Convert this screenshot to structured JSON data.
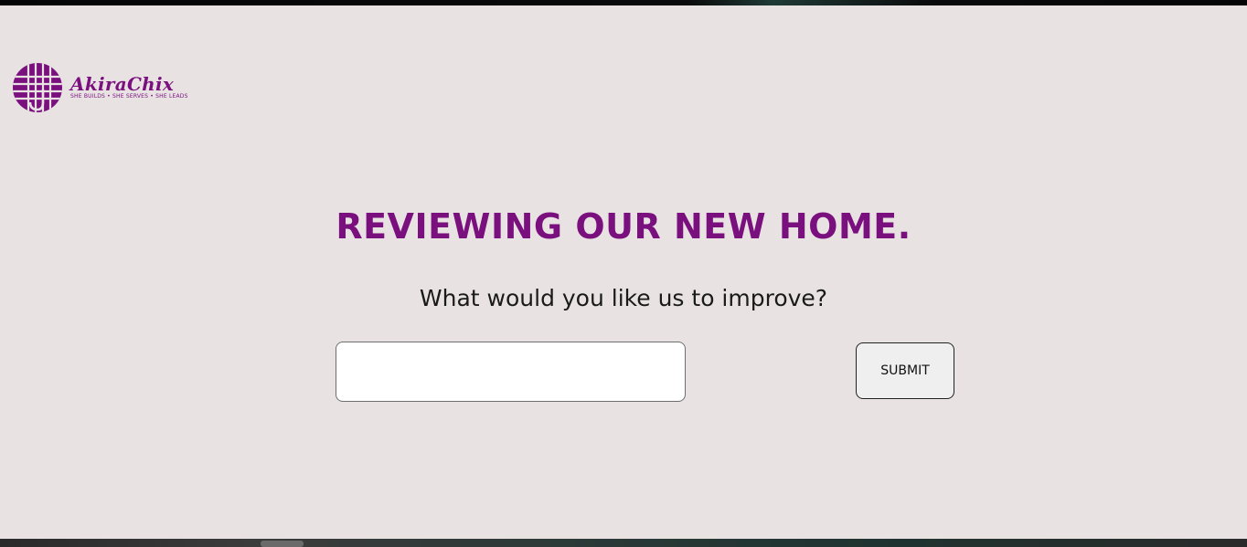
{
  "logo": {
    "name": "AkiraChix",
    "tagline": "SHE BUILDS • SHE SERVES • SHE LEADS",
    "color": "#7a0f7e"
  },
  "main": {
    "heading": "REVIEWING OUR NEW HOME.",
    "question": "What would you like us to improve?"
  },
  "form": {
    "feedback_value": "",
    "feedback_placeholder": "",
    "submit_label": "SUBMIT"
  },
  "colors": {
    "panel_background": "#e8e2e3",
    "accent": "#7a0f7e"
  }
}
